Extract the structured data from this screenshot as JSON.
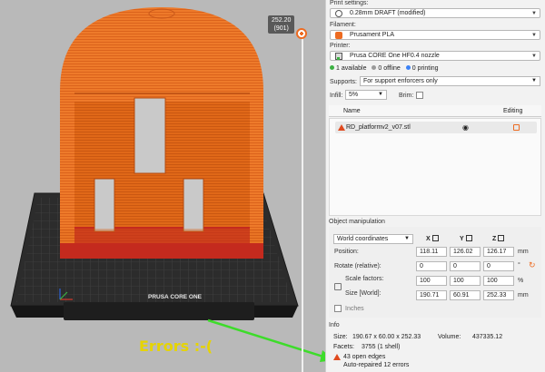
{
  "viewport": {
    "slider_value": "252.20",
    "slider_layer": "(901)",
    "bed_logo": "PRUSA CORE ONE",
    "callout": "Errors :-("
  },
  "sidebar": {
    "print_settings_label": "Print settings:",
    "print_settings_value": "0.28mm DRAFT (modified)",
    "filament_label": "Filament:",
    "filament_value": "Prusament PLA",
    "printer_label": "Printer:",
    "printer_value": "Prusa CORE One HF0.4 nozzle",
    "status": {
      "available": "1 available",
      "offline": "0 offline",
      "printing": "0 printing",
      "available_color": "#3cb043",
      "offline_color": "#9a9a9a",
      "printing_color": "#3b82f6"
    },
    "supports_label": "Supports:",
    "supports_value": "For support enforcers only",
    "infill_label": "Infill:",
    "infill_value": "5%",
    "brim_label": "Brim:",
    "list_col_name": "Name",
    "list_col_editing": "Editing",
    "object_name": "RD_platformv2_v07.stl"
  },
  "object_manipulation": {
    "title": "Object manipulation",
    "coord_system": "World coordinates",
    "axes": [
      "X",
      "Y",
      "Z"
    ],
    "position_label": "Position:",
    "position": [
      "118.11",
      "126.02",
      "126.17"
    ],
    "rotate_label": "Rotate (relative):",
    "rotate": [
      "0",
      "0",
      "0"
    ],
    "scale_label": "Scale factors:",
    "scale": [
      "100",
      "100",
      "100"
    ],
    "size_label": "Size [World]:",
    "size": [
      "190.71",
      "60.91",
      "252.33"
    ],
    "unit_mm": "mm",
    "unit_deg": "°",
    "unit_pct": "%",
    "inches_label": "Inches"
  },
  "info": {
    "title": "Info",
    "size_label": "Size:",
    "size_value": "190.67 x 60.00 x 252.33",
    "volume_label": "Volume:",
    "volume_value": "437335.12",
    "facets_label": "Facets:",
    "facets_value": "3755 (1 shell)",
    "open_edges": "43 open edges",
    "auto_repaired": "Auto-repaired 12 errors"
  },
  "colors": {
    "accent": "#ed6b21",
    "error": "#e04a1f",
    "callout": "#e6d400",
    "arrow": "#3ddc2a"
  }
}
